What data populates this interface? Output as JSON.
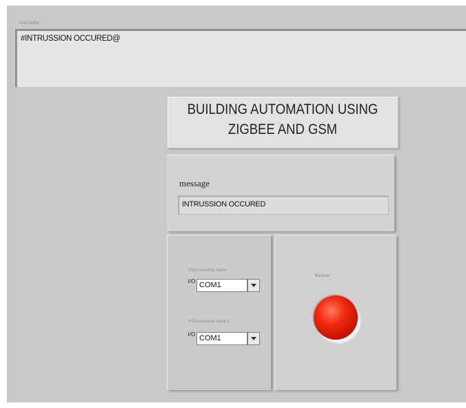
{
  "read_buffer": {
    "label": "read buffer",
    "value": "#INTRUSSION OCCURED@"
  },
  "title": {
    "line1": "BUILDING AUTOMATION USING",
    "line2": "ZIGBEE AND GSM"
  },
  "message": {
    "label": "message",
    "value": "INTRUSSION OCCURED"
  },
  "visa_1": {
    "label": "VISA resource name",
    "io_glyph": "I/O",
    "value": "COM1"
  },
  "visa_2": {
    "label": "VISA resource name 2",
    "io_glyph": "I/O",
    "value": "COM1"
  },
  "led": {
    "label": "Boolean",
    "state": "on",
    "color": "#e8200a"
  },
  "colors": {
    "panel_background": "#c9c9c9",
    "indicator_background": "#e6e6e6"
  }
}
